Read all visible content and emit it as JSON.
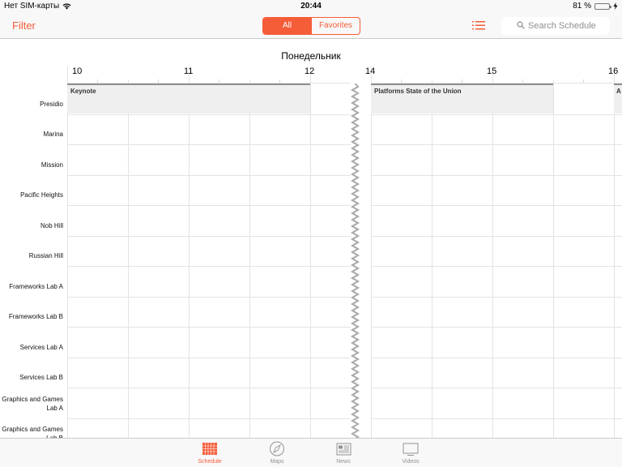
{
  "status_bar": {
    "carrier": "Нет SIM-карты",
    "time": "20:44",
    "battery_percent": "81 %",
    "battery_level": 0.81
  },
  "nav": {
    "filter_label": "Filter",
    "segments": [
      "All",
      "Favorites"
    ],
    "selected_segment": "All",
    "search_placeholder": "Search Schedule",
    "accent_color": "#f55c38"
  },
  "schedule": {
    "day": "Понедельник",
    "hours": [
      "10",
      "11",
      "12",
      "14",
      "15",
      "16"
    ],
    "rooms": [
      "Presidio",
      "Marina",
      "Mission",
      "Pacific Heights",
      "Nob Hill",
      "Russian Hill",
      "Frameworks Lab A",
      "Frameworks Lab B",
      "Services Lab A",
      "Services Lab B",
      "Graphics and Games Lab A",
      "Graphics and Games Lab B"
    ],
    "events": [
      {
        "title": "Keynote",
        "room": "Presidio",
        "start": "10:00",
        "end": "12:00"
      },
      {
        "title": "Platforms State of the Union",
        "room": "Presidio",
        "start": "14:00",
        "end": "15:30"
      },
      {
        "title": "A",
        "room": "Presidio",
        "start": "16:00",
        "end": ""
      }
    ]
  },
  "tab_bar": {
    "items": [
      {
        "label": "Schedule",
        "icon": "calendar-grid-icon",
        "active": true
      },
      {
        "label": "Maps",
        "icon": "compass-icon",
        "active": false
      },
      {
        "label": "News",
        "icon": "newspaper-icon",
        "active": false
      },
      {
        "label": "Videos",
        "icon": "tv-icon",
        "active": false
      }
    ]
  }
}
